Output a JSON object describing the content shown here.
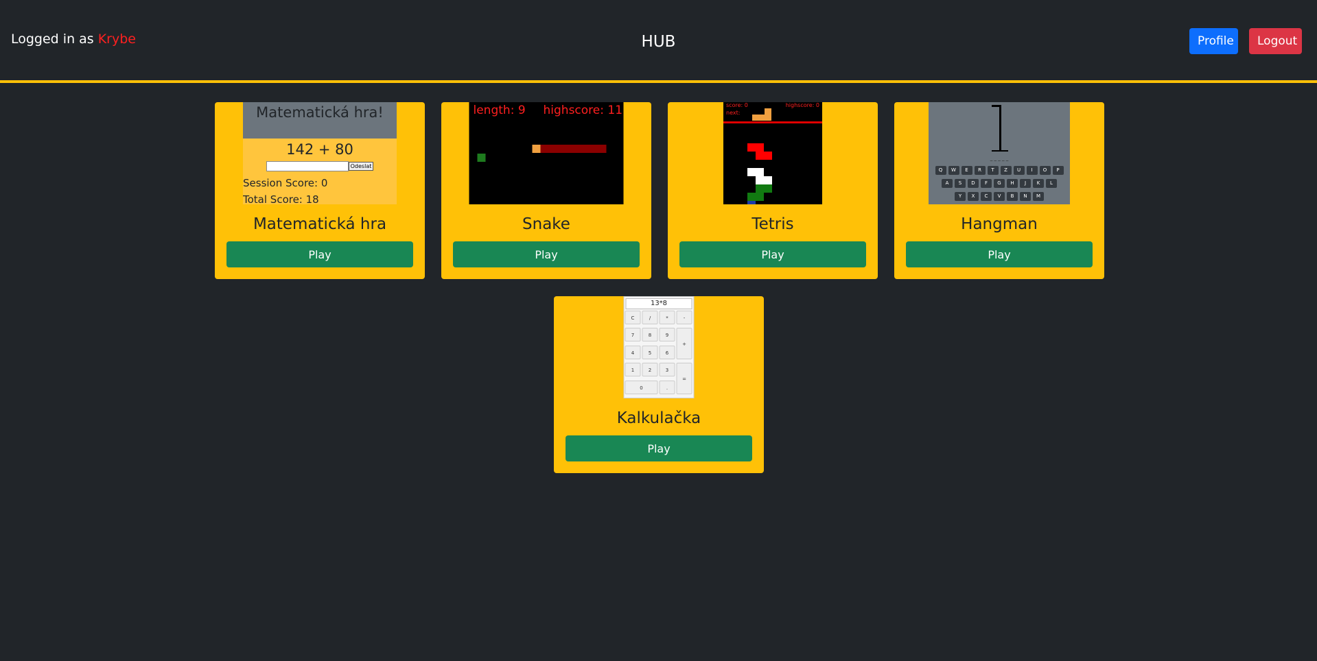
{
  "header": {
    "logged_in_label": "Logged in as",
    "username": "Krybe",
    "title": "HUB",
    "profile_button": "Profile",
    "logout_button": "Logout"
  },
  "colors": {
    "background": "#212529",
    "accent": "#ffc107",
    "play_button": "#198754",
    "profile_button": "#0d6efd",
    "logout_button": "#dc3545",
    "username": "#ff2020"
  },
  "games": [
    {
      "name": "Matematická hra",
      "play_label": "Play",
      "preview": {
        "title": "Matematická hra!",
        "equation": "142 + 80",
        "submit_label": "Odeslat",
        "session_score": "Session Score: 0",
        "total_score": "Total Score: 18"
      }
    },
    {
      "name": "Snake",
      "play_label": "Play",
      "preview": {
        "length": "length: 9",
        "highscore": "highscore: 11"
      }
    },
    {
      "name": "Tetris",
      "play_label": "Play",
      "preview": {
        "score": "score: 0",
        "next": "next:",
        "highscore": "highscore: 0"
      }
    },
    {
      "name": "Hangman",
      "play_label": "Play",
      "preview": {
        "word_blanks": "_ _ _ _ _",
        "keys_row1": [
          "Q",
          "W",
          "E",
          "R",
          "T",
          "Z",
          "U",
          "I",
          "O",
          "P"
        ],
        "keys_row2": [
          "A",
          "S",
          "D",
          "F",
          "G",
          "H",
          "J",
          "K",
          "L"
        ],
        "keys_row3": [
          "Y",
          "X",
          "C",
          "V",
          "B",
          "N",
          "M"
        ]
      }
    },
    {
      "name": "Kalkulačka",
      "play_label": "Play",
      "preview": {
        "display": "13*8",
        "buttons": [
          "C",
          "/",
          "*",
          "-",
          "7",
          "8",
          "9",
          "+",
          "4",
          "5",
          "6",
          "1",
          "2",
          "3",
          "=",
          "0",
          "."
        ]
      }
    }
  ]
}
